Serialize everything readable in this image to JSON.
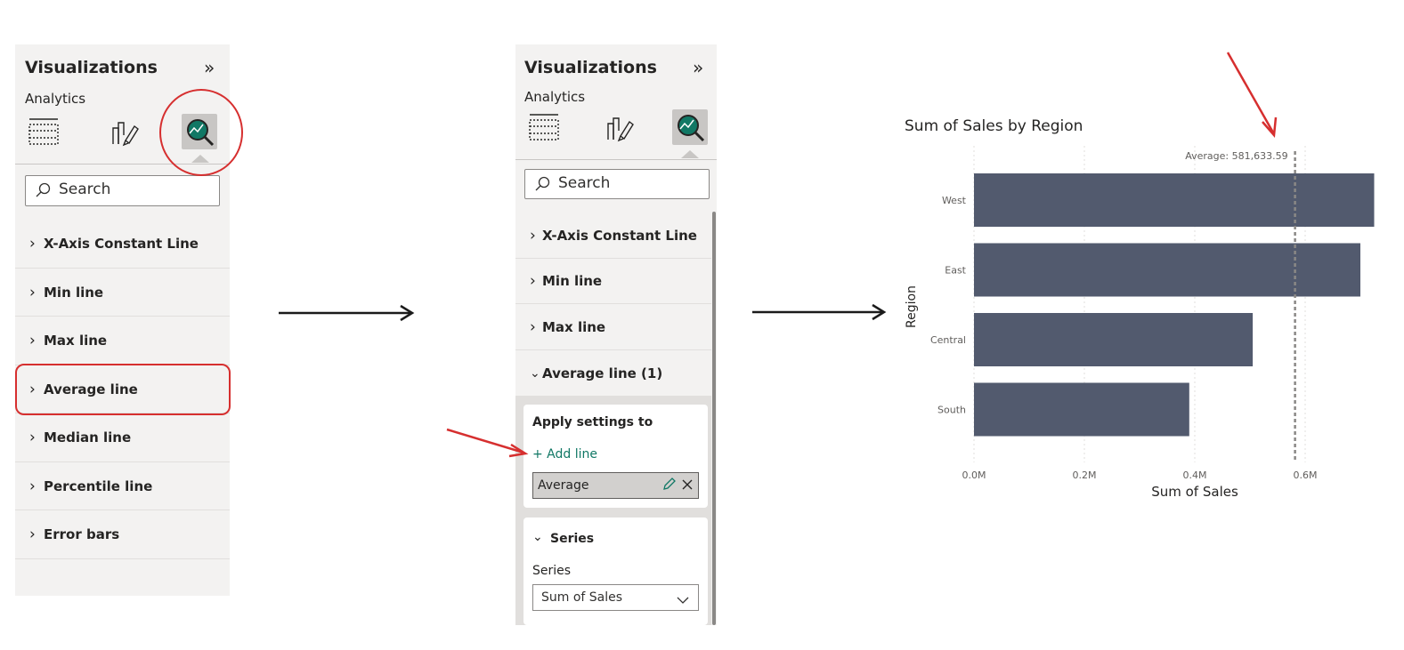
{
  "panel1": {
    "title": "Visualizations",
    "subtitle": "Analytics",
    "search_placeholder": "Search",
    "sections": [
      "X-Axis Constant Line",
      "Min line",
      "Max line",
      "Average line",
      "Median line",
      "Percentile line",
      "Error bars"
    ]
  },
  "panel2": {
    "title": "Visualizations",
    "subtitle": "Analytics",
    "search_placeholder": "Search",
    "sections": [
      "X-Axis Constant Line",
      "Min line",
      "Max line"
    ],
    "expanded_section": "Average line (1)",
    "apply_settings_label": "Apply settings to",
    "add_line_label": "+ Add line",
    "selected_line": "Average",
    "series_section_label": "Series",
    "series_field_label": "Series",
    "series_selected": "Sum of Sales"
  },
  "chart_data": {
    "type": "bar",
    "orientation": "horizontal",
    "title": "Sum of Sales by Region",
    "xlabel": "Sum of Sales",
    "ylabel": "Region",
    "categories": [
      "West",
      "East",
      "Central",
      "South"
    ],
    "values": [
      725000,
      700000,
      505000,
      390000
    ],
    "xlim": [
      0,
      700000
    ],
    "x_ticks": [
      "0.0M",
      "0.2M",
      "0.4M",
      "0.6M"
    ],
    "average_line": {
      "label": "Average: 581,633.59",
      "value": 581633.59
    },
    "colors": {
      "bar": "#525a6e"
    }
  },
  "colors": {
    "annotation": "#d62f2f",
    "accent": "#117865",
    "pane": "#f3f2f1"
  }
}
